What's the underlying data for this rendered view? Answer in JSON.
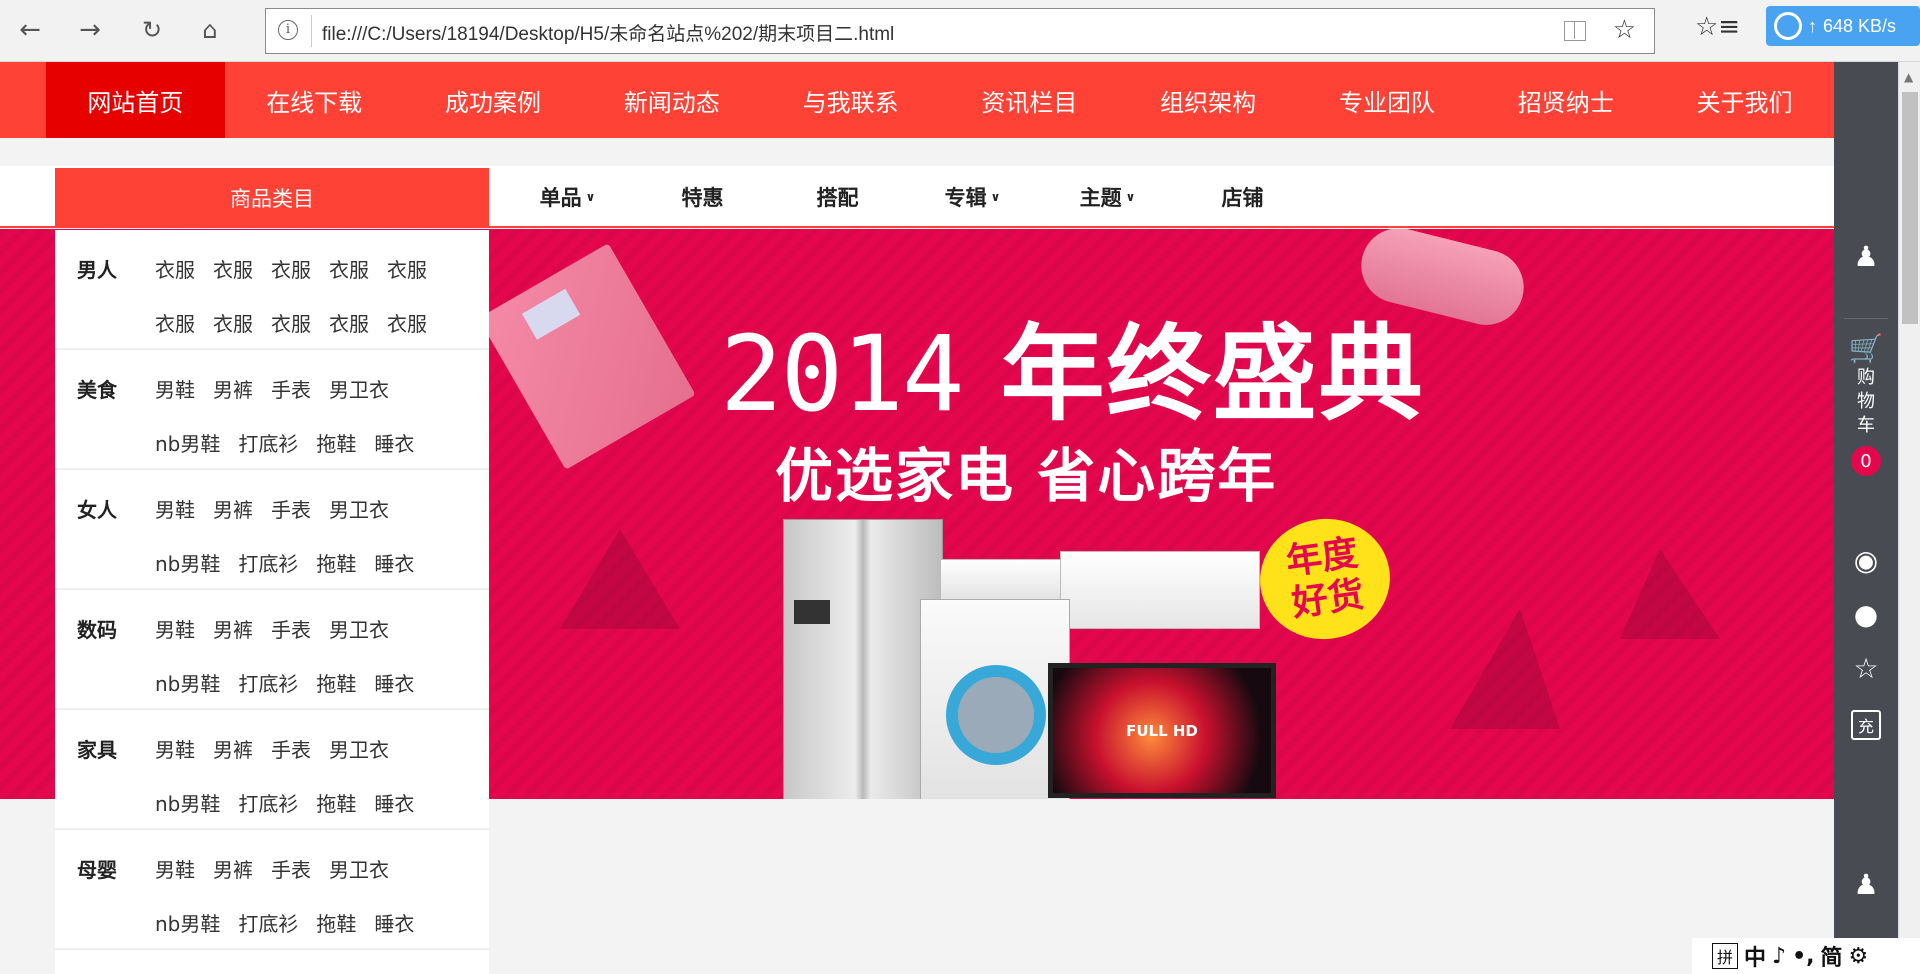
{
  "browser": {
    "url": "file:///C:/Users/18194/Desktop/H5/未命名站点%202/期末项目二.html",
    "speed": "648 KB/s",
    "icons": [
      "back-arrow-icon",
      "forward-arrow-icon",
      "refresh-icon",
      "home-icon",
      "info-icon",
      "reading-view-icon",
      "favorite-star-icon",
      "favorites-list-icon",
      "cloud-icon"
    ]
  },
  "site_nav": {
    "items": [
      "网站首页",
      "在线下载",
      "成功案例",
      "新闻动态",
      "与我联系",
      "资讯栏目",
      "组织架构",
      "专业团队",
      "招贤纳士",
      "关于我们"
    ],
    "active_index": 0
  },
  "category_header": "商品类目",
  "sub_tabs": [
    {
      "label": "单品",
      "dropdown": true
    },
    {
      "label": "特惠",
      "dropdown": false
    },
    {
      "label": "搭配",
      "dropdown": false
    },
    {
      "label": "专辑",
      "dropdown": true
    },
    {
      "label": "主题",
      "dropdown": true
    },
    {
      "label": "店铺",
      "dropdown": false
    }
  ],
  "categories": [
    {
      "name": "男人",
      "line1": [
        "衣服",
        "衣服",
        "衣服",
        "衣服",
        "衣服"
      ],
      "line2": [
        "衣服",
        "衣服",
        "衣服",
        "衣服",
        "衣服"
      ]
    },
    {
      "name": "美食",
      "line1": [
        "男鞋",
        "男裤",
        "手表",
        "男卫衣"
      ],
      "line2": [
        "nb男鞋",
        "打底衫",
        "拖鞋",
        "睡衣"
      ]
    },
    {
      "name": "女人",
      "line1": [
        "男鞋",
        "男裤",
        "手表",
        "男卫衣"
      ],
      "line2": [
        "nb男鞋",
        "打底衫",
        "拖鞋",
        "睡衣"
      ]
    },
    {
      "name": "数码",
      "line1": [
        "男鞋",
        "男裤",
        "手表",
        "男卫衣"
      ],
      "line2": [
        "nb男鞋",
        "打底衫",
        "拖鞋",
        "睡衣"
      ]
    },
    {
      "name": "家具",
      "line1": [
        "男鞋",
        "男裤",
        "手表",
        "男卫衣"
      ],
      "line2": [
        "nb男鞋",
        "打底衫",
        "拖鞋",
        "睡衣"
      ]
    },
    {
      "name": "母婴",
      "line1": [
        "男鞋",
        "男裤",
        "手表",
        "男卫衣"
      ],
      "line2": [
        "nb男鞋",
        "打底衫",
        "拖鞋",
        "睡衣"
      ]
    }
  ],
  "banner": {
    "year": "2014",
    "title": "年终盛典",
    "subtitle": "优选家电  省心跨年",
    "badge_line1": "年度",
    "badge_line2": "好货",
    "tv_text": "FULL HD",
    "colors": {
      "background": "#e4074d",
      "badge": "#ffe21a"
    }
  },
  "toolbar": {
    "cart_label": "购物车",
    "cart_count": "0",
    "recharge_label": "充",
    "icons": [
      "user-icon",
      "cart-icon",
      "money-bag-icon",
      "footprint-icon",
      "star-icon",
      "recharge-icon",
      "customer-service-icon"
    ]
  },
  "ime": {
    "mode_box": "拼",
    "lang": "中",
    "punct": "♪",
    "dot": "•,",
    "script": "简",
    "gear": "⚙"
  },
  "colors": {
    "nav_red": "#ff4136",
    "nav_active": "#e60000",
    "toolbar": "#484b51"
  }
}
